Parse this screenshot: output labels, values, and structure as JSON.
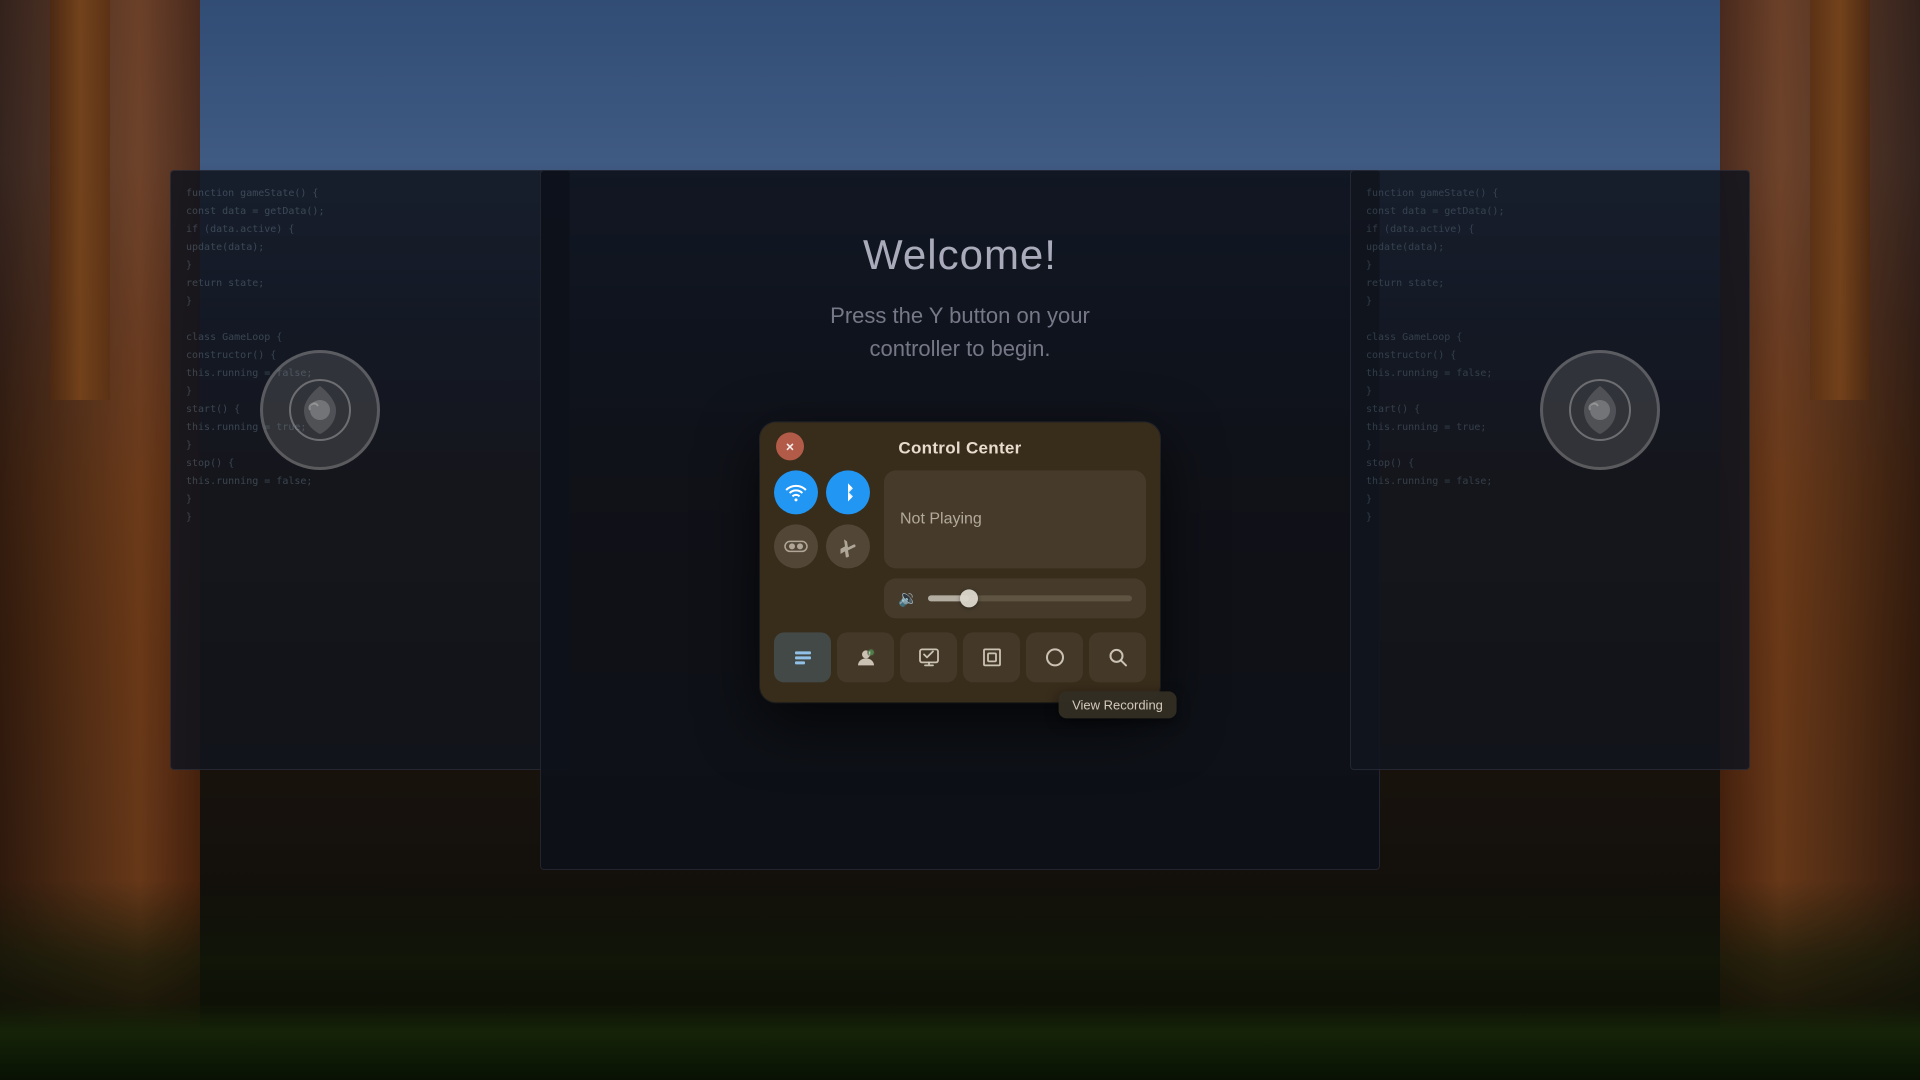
{
  "background": {
    "welcome_title": "Welcome!",
    "welcome_subtitle": "Press the Y button on your\ncontroller to begin."
  },
  "control_center": {
    "title": "Control Center",
    "close_button_label": "×",
    "toggles": {
      "wifi": {
        "icon": "wifi",
        "active": true,
        "label": "WiFi"
      },
      "bluetooth": {
        "icon": "bluetooth",
        "active": true,
        "label": "Bluetooth"
      },
      "vr": {
        "icon": "vr",
        "active": false,
        "label": "VR"
      },
      "airplane": {
        "icon": "airplane",
        "active": false,
        "label": "Airplane Mode"
      }
    },
    "now_playing": {
      "text": "Not Playing"
    },
    "volume": {
      "icon": "🔉",
      "level": 20
    },
    "toolbar": {
      "buttons": [
        {
          "id": "home",
          "icon": "⊟",
          "label": "Home",
          "active": true
        },
        {
          "id": "profile",
          "icon": "👤",
          "label": "Profile",
          "active": false
        },
        {
          "id": "display",
          "icon": "🖥",
          "label": "Display",
          "active": false
        },
        {
          "id": "screenshot",
          "icon": "⧉",
          "label": "Screenshot",
          "active": false
        },
        {
          "id": "circle",
          "icon": "○",
          "label": "Circle",
          "active": false
        },
        {
          "id": "search",
          "icon": "🔍",
          "label": "Search",
          "active": false
        }
      ]
    },
    "tooltip": {
      "text": "View Recording"
    }
  },
  "code_lines": [
    "function gameState() {",
    "  const data = getData();",
    "  if (data.active) {",
    "    update(data);",
    "  }",
    "  return state;",
    "}",
    "",
    "class GameLoop {",
    "  constructor() {",
    "    this.running = false;",
    "  }",
    "  start() {",
    "    this.running = true;",
    "  }",
    "  stop() {",
    "    this.running = false;",
    "  }",
    "}"
  ]
}
